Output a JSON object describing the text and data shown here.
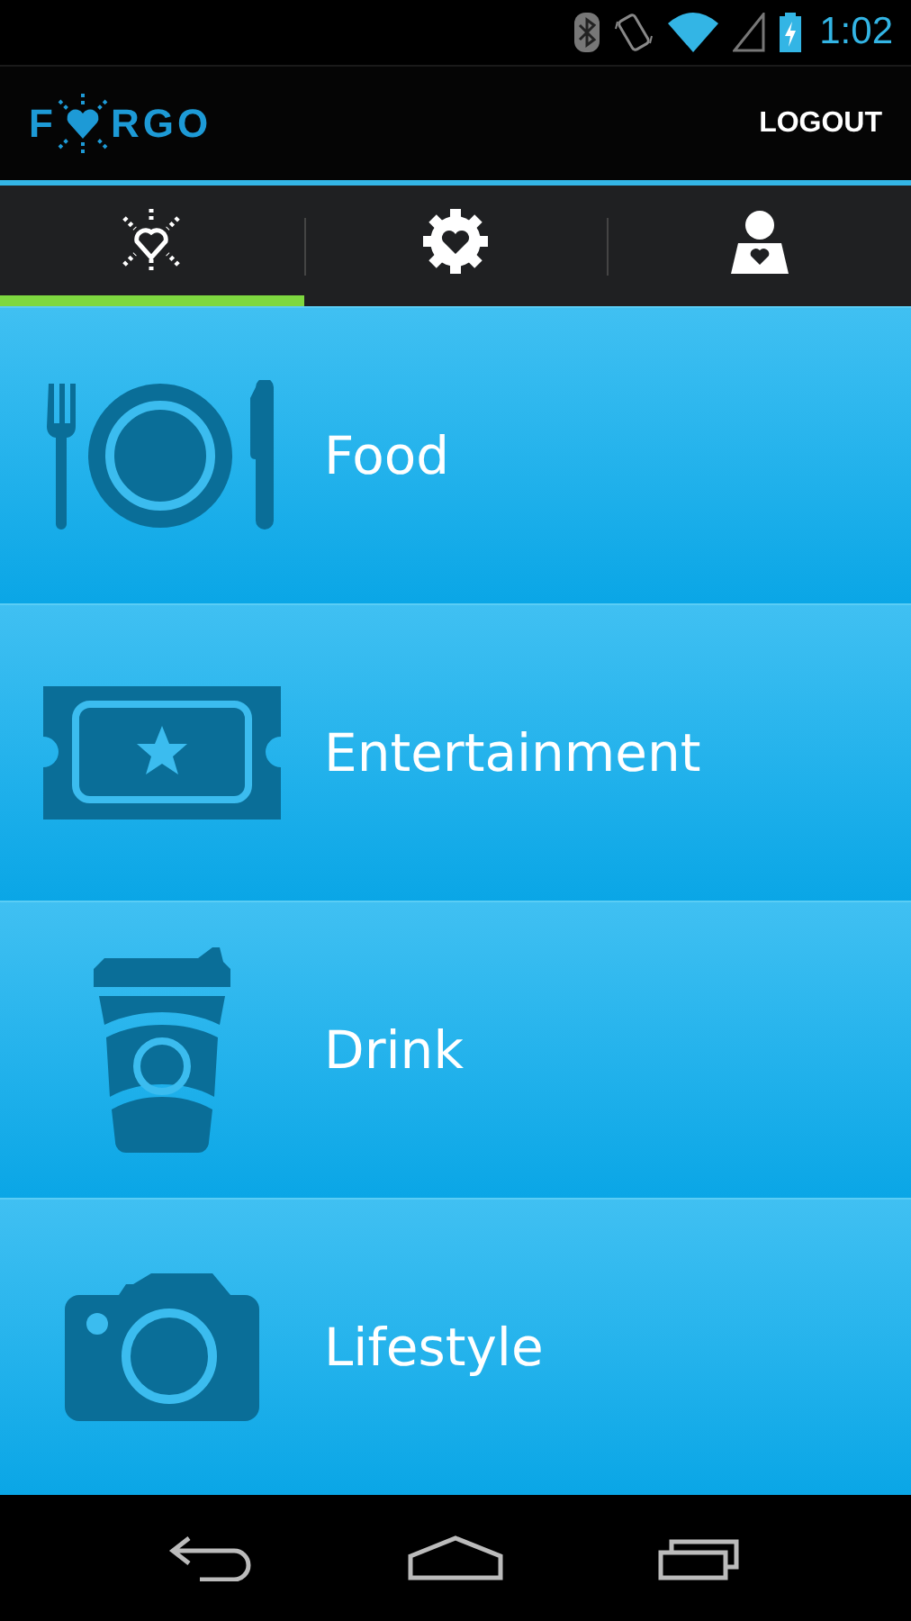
{
  "status_bar": {
    "time": "1:02",
    "battery_charging": true
  },
  "action_bar": {
    "logo_start": "F",
    "logo_end": "RGO",
    "action": "LOGOUT"
  },
  "tabs": [
    {
      "kind": "sunheart",
      "selected": true
    },
    {
      "kind": "gearheart",
      "selected": false
    },
    {
      "kind": "personheart",
      "selected": false
    }
  ],
  "categories": [
    {
      "kind": "food",
      "label": "Food"
    },
    {
      "kind": "ticket",
      "label": "Entertainment"
    },
    {
      "kind": "cup",
      "label": "Drink"
    },
    {
      "kind": "camera",
      "label": "Lifestyle"
    }
  ]
}
